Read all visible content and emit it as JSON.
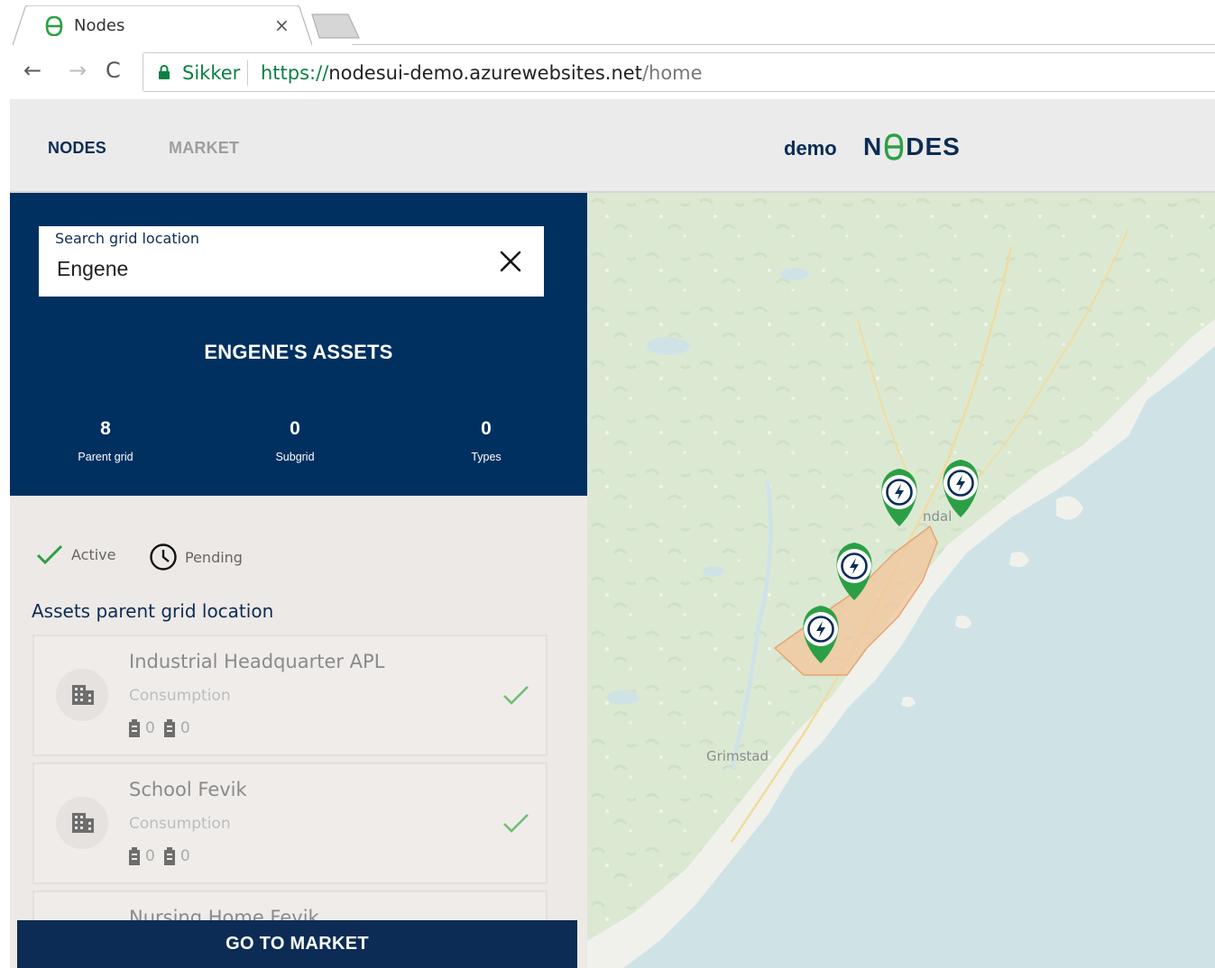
{
  "browser": {
    "tab_title": "Nodes",
    "tab_close": "×",
    "secure_label": "Sikker",
    "url": {
      "scheme": "https://",
      "host": "nodesui-demo.azurewebsites.net",
      "path": "/home"
    }
  },
  "header": {
    "nav": [
      {
        "label": "NODES",
        "active": true
      },
      {
        "label": "MARKET",
        "active": false
      }
    ],
    "tenant": "demo",
    "logo_text": {
      "left": "N",
      "right": "DES"
    }
  },
  "search": {
    "label": "Search grid location",
    "value": "Engene"
  },
  "summary": {
    "title": "ENGENE'S ASSETS",
    "stats": [
      {
        "value": "8",
        "label": "Parent grid"
      },
      {
        "value": "0",
        "label": "Subgrid"
      },
      {
        "value": "0",
        "label": "Types"
      }
    ]
  },
  "legend": {
    "active": "Active",
    "pending": "Pending"
  },
  "assets": {
    "section_title": "Assets parent grid location",
    "items": [
      {
        "name": "Industrial Headquarter APL",
        "type": "Consumption",
        "count_a": "0",
        "count_b": "0",
        "status": "active"
      },
      {
        "name": "School Fevik",
        "type": "Consumption",
        "count_a": "0",
        "count_b": "0",
        "status": "active"
      },
      {
        "name": "Nursing Home Fevik",
        "type": "",
        "count_a": "",
        "count_b": "",
        "status": "active"
      }
    ]
  },
  "footer_button": "GO TO MARKET",
  "map": {
    "labels": {
      "town_1": "ndal",
      "town_2": "Grimstad"
    }
  },
  "colors": {
    "navy": "#003060",
    "brand_dark": "#0c2c55",
    "marker_green": "#2c9f45",
    "check_green": "#4caf50",
    "secure_green": "#0b8043"
  }
}
